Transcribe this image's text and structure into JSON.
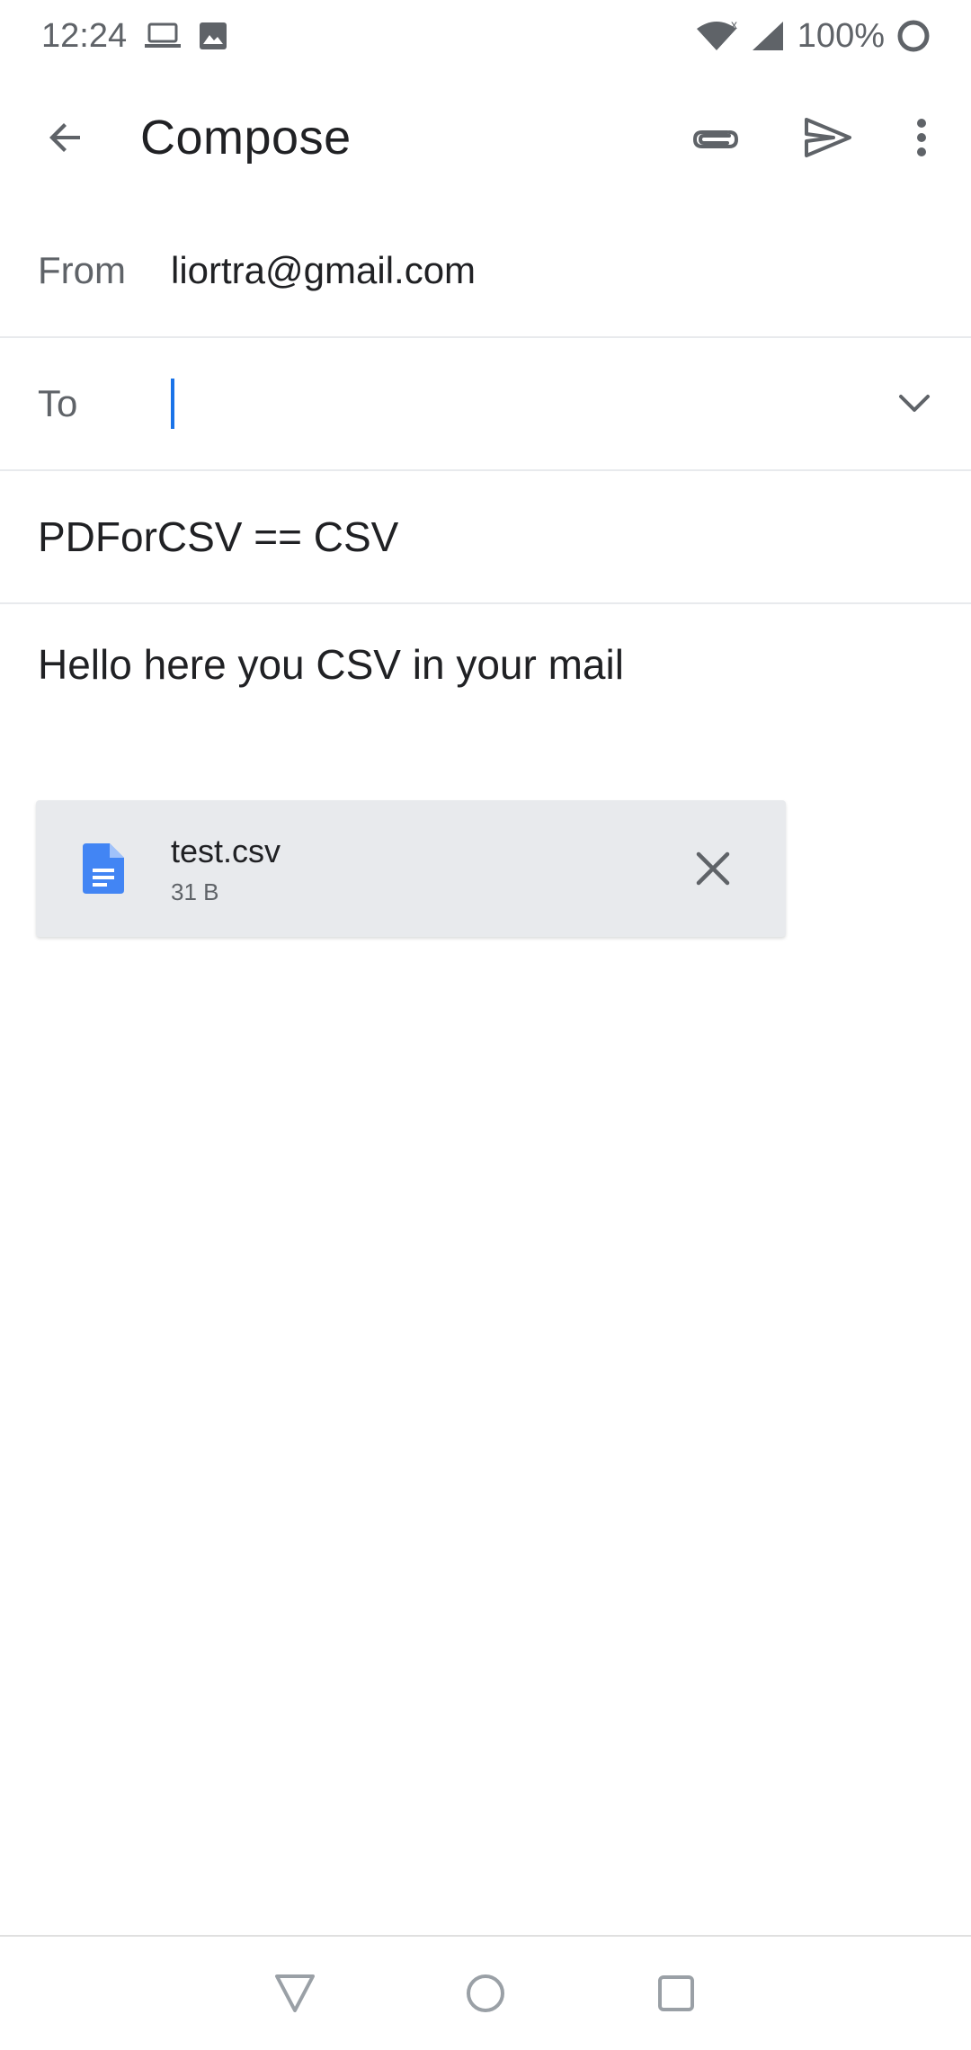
{
  "status_bar": {
    "time": "12:24",
    "battery": "100%",
    "icons": [
      "laptop-icon",
      "image-icon",
      "wifi-icon",
      "signal-icon",
      "battery-icon"
    ]
  },
  "app_bar": {
    "title": "Compose",
    "actions": [
      "attach-icon",
      "send-icon",
      "more-vert-icon"
    ]
  },
  "compose": {
    "from_label": "From",
    "from_value": "liortra@gmail.com",
    "to_label": "To",
    "to_value": "",
    "subject": "PDForCSV == CSV",
    "body": "Hello here you CSV in your mail"
  },
  "attachment": {
    "name": "test.csv",
    "size": "31 B",
    "icon": "document-icon"
  },
  "colors": {
    "accent": "#1a73e8",
    "doc_icon": "#4285f4",
    "attachment_bg": "#e8eaed",
    "secondary_text": "#5f6368"
  }
}
